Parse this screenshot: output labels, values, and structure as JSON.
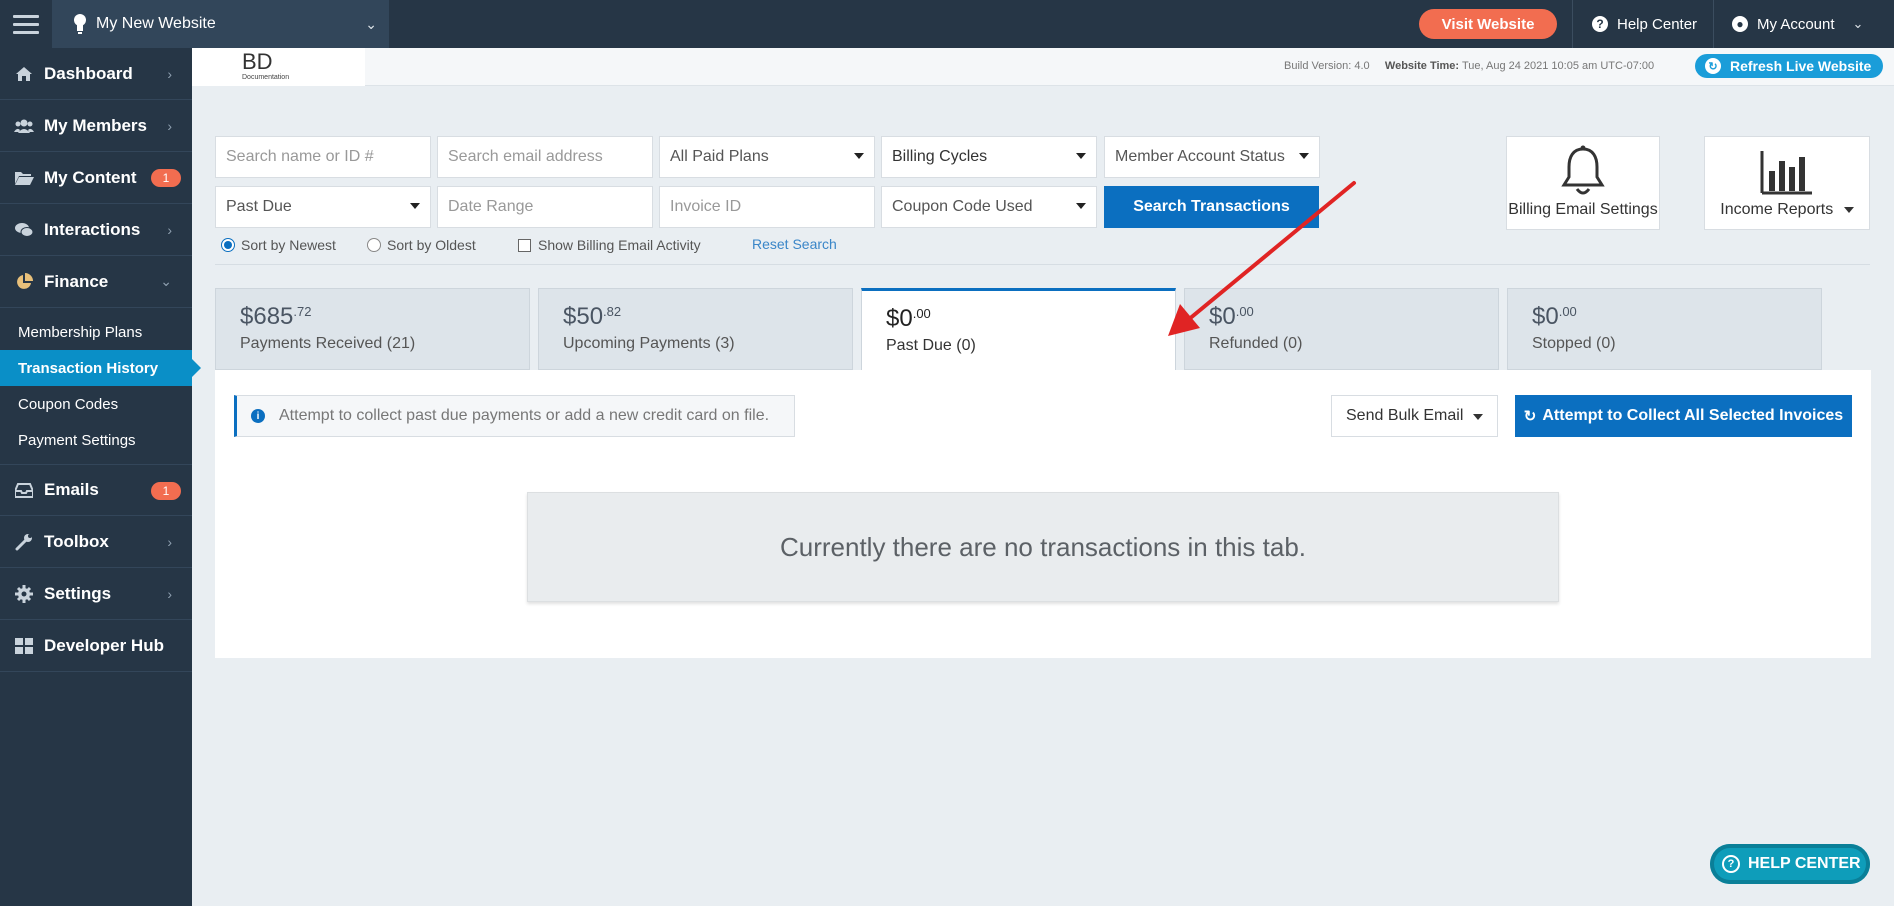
{
  "topbar": {
    "site_name": "My New Website",
    "visit_label": "Visit Website",
    "help_label": "Help Center",
    "account_label": "My Account"
  },
  "sidebar": {
    "items": [
      {
        "label": "Dashboard"
      },
      {
        "label": "My Members"
      },
      {
        "label": "My Content",
        "badge": "1"
      },
      {
        "label": "Interactions"
      },
      {
        "label": "Finance"
      },
      {
        "label": "Emails",
        "badge": "1"
      },
      {
        "label": "Toolbox"
      },
      {
        "label": "Settings"
      },
      {
        "label": "Developer Hub"
      }
    ],
    "finance_sub": [
      "Membership Plans",
      "Transaction History",
      "Coupon Codes",
      "Payment Settings"
    ]
  },
  "header": {
    "logo": "BD",
    "logo_sub": "Documentation",
    "build_label": "Build Version:",
    "build_value": "4.0",
    "time_label": "Website Time:",
    "time_value": "Tue, Aug 24 2021 10:05 am UTC-07:00",
    "refresh_label": "Refresh Live Website"
  },
  "filters": {
    "name_placeholder": "Search name or ID #",
    "email_placeholder": "Search email address",
    "plans_value": "All Paid Plans",
    "billing_value": "Billing Cycles",
    "status_value": "Member Account Status",
    "pastdue_value": "Past Due",
    "date_placeholder": "Date Range",
    "invoice_placeholder": "Invoice ID",
    "coupon_value": "Coupon Code Used",
    "search_label": "Search Transactions",
    "sort_newest": "Sort by Newest",
    "sort_oldest": "Sort by Oldest",
    "show_billing": "Show Billing Email Activity",
    "reset_label": "Reset Search"
  },
  "tools": {
    "billing_email_label": "Billing Email Settings",
    "income_reports_label": "Income Reports"
  },
  "tabs": [
    {
      "dollars": "$685",
      "cents": ".72",
      "label": "Payments Received (21)"
    },
    {
      "dollars": "$50",
      "cents": ".82",
      "label": "Upcoming Payments (3)"
    },
    {
      "dollars": "$0",
      "cents": ".00",
      "label": "Past Due (0)"
    },
    {
      "dollars": "$0",
      "cents": ".00",
      "label": "Refunded (0)"
    },
    {
      "dollars": "$0",
      "cents": ".00",
      "label": "Stopped (0)"
    }
  ],
  "panel": {
    "info_text": "Attempt to collect past due payments or add a new credit card on file.",
    "bulk_email_label": "Send Bulk Email",
    "collect_label": "Attempt to Collect All Selected Invoices",
    "empty_text": "Currently there are no transactions in this tab."
  },
  "help_center_button": "HELP CENTER",
  "colors": {
    "nav_bg": "#263646",
    "accent_blue": "#0b6fc0",
    "orange": "#f26d50",
    "active_sub": "#0a8fc7",
    "teal": "#0e9dba",
    "annotation_red": "#e02424"
  }
}
